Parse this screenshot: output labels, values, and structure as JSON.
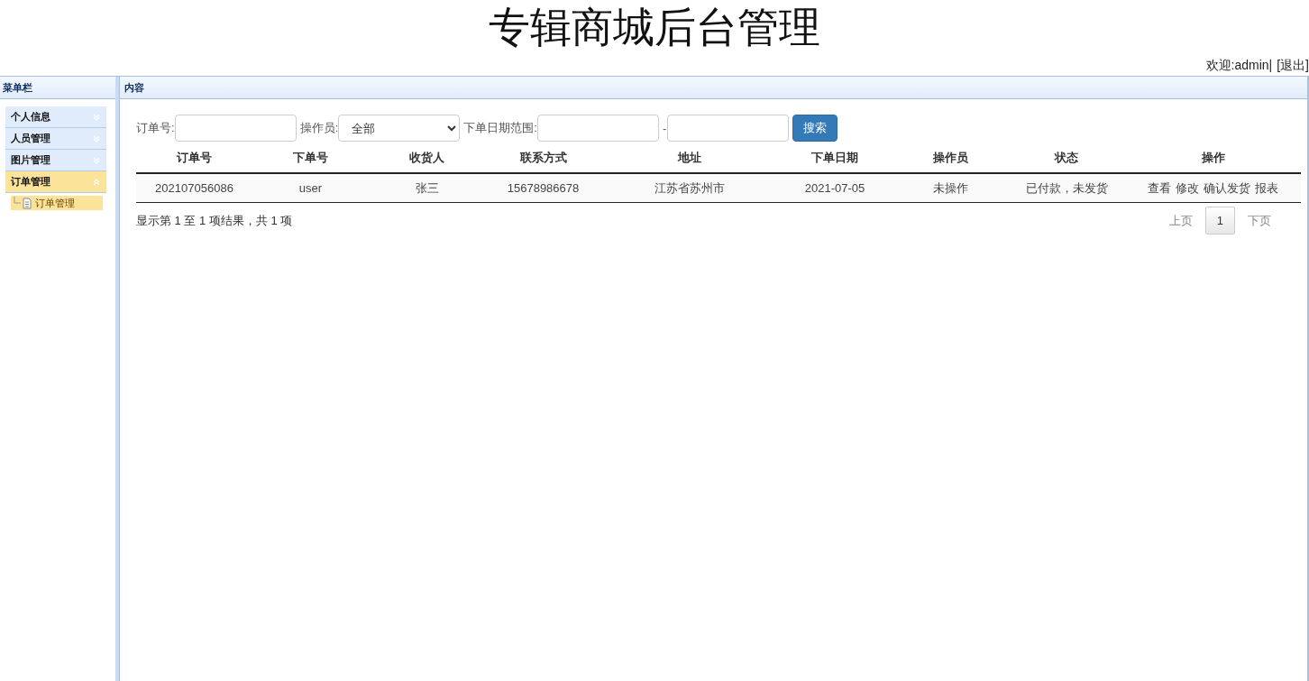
{
  "header": {
    "title": "专辑商城后台管理",
    "welcome": "欢迎:admin|",
    "logout": "[退出]"
  },
  "sidebar": {
    "title": "菜单栏",
    "groups": [
      {
        "label": "个人信息",
        "expanded": false,
        "selected": false
      },
      {
        "label": "人员管理",
        "expanded": false,
        "selected": false
      },
      {
        "label": "图片管理",
        "expanded": false,
        "selected": false
      },
      {
        "label": "订单管理",
        "expanded": true,
        "selected": true,
        "children": [
          {
            "label": "订单管理",
            "selected": true
          }
        ]
      }
    ]
  },
  "content": {
    "title": "内容",
    "filters": {
      "order_label": "订单号:",
      "operator_label": "操作员:",
      "operator_value": "全部",
      "date_label": "下单日期范围:",
      "date_separator": "-",
      "search_button": "搜索"
    },
    "table": {
      "columns": [
        "订单号",
        "下单号",
        "收货人",
        "联系方式",
        "地址",
        "下单日期",
        "操作员",
        "状态",
        "操作"
      ],
      "rows": [
        {
          "cells": [
            "202107056086",
            "user",
            "张三",
            "15678986678",
            "江苏省苏州市",
            "2021-07-05",
            "未操作",
            "已付款，未发货"
          ],
          "actions": [
            "查看",
            "修改",
            "确认发货",
            "报表"
          ]
        }
      ]
    },
    "summary": "显示第 1 至 1 项结果，共 1 项",
    "pagination": {
      "prev": "上页",
      "pages": [
        {
          "label": "1",
          "selected": true
        }
      ],
      "next": "下页"
    }
  }
}
